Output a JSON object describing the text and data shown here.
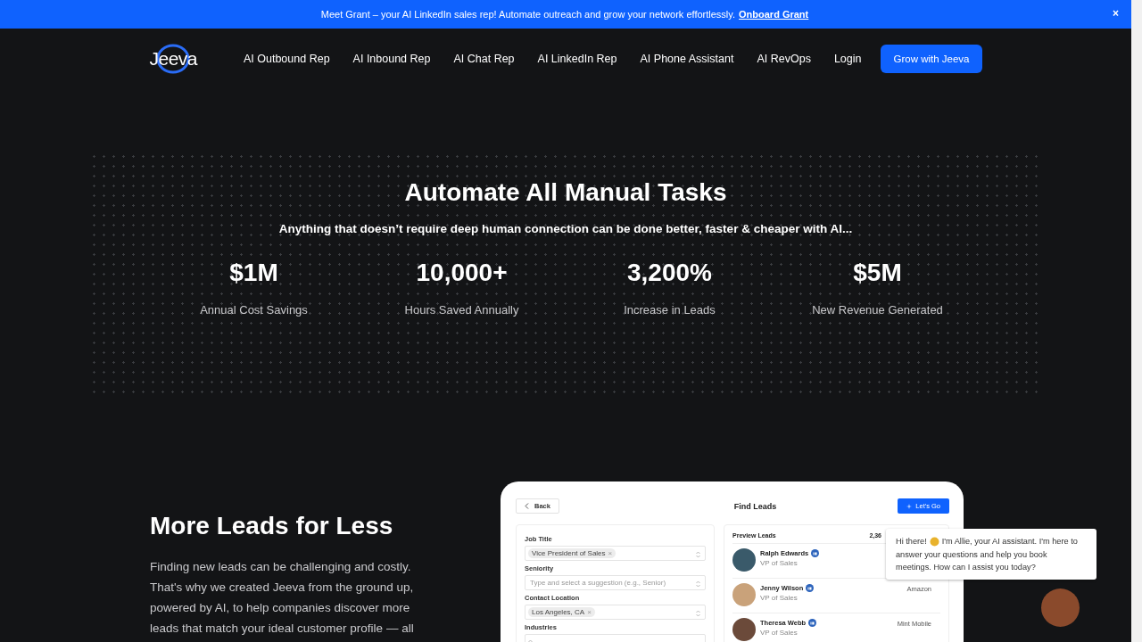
{
  "banner": {
    "text": "Meet Grant – your AI LinkedIn sales rep! Automate outreach and grow your network effortlessly.",
    "link": "Onboard Grant",
    "close": "×"
  },
  "nav": {
    "logo": "Jeeva",
    "links": [
      "AI Outbound Rep",
      "AI Inbound Rep",
      "AI Chat Rep",
      "AI LinkedIn Rep",
      "AI Phone Assistant",
      "AI RevOps",
      "Login"
    ],
    "cta": "Grow with Jeeva"
  },
  "hero": {
    "title": "Automate All Manual Tasks",
    "subtitle": "Anything that doesn’t require deep human connection can be done better, faster & cheaper with AI...",
    "stats": [
      {
        "value": "$1M",
        "label": "Annual Cost Savings"
      },
      {
        "value": "10,000+",
        "label": "Hours Saved Annually"
      },
      {
        "value": "3,200%",
        "label": "Increase in Leads"
      },
      {
        "value": "$5M",
        "label": "New Revenue Generated"
      }
    ]
  },
  "leads_section": {
    "title": "More Leads for Less",
    "body": "Finding new leads can be challenging and costly. That's why we created Jeeva from the ground up, powered by AI, to help companies discover more leads that match your ideal customer profile — all"
  },
  "find_leads": {
    "back": "Back",
    "title": "Find Leads",
    "go": "Let's Go",
    "filters": [
      {
        "label": "Job Title",
        "chip": "Vice President of Sales",
        "remove": "×"
      },
      {
        "label": "Seniority",
        "placeholder": "Type and select a suggestion (e.g., Senior)"
      },
      {
        "label": "Contact Location",
        "chip": "Los Angeles, CA",
        "remove": "×"
      },
      {
        "label": "Industries"
      }
    ],
    "preview": {
      "title": "Preview Leads",
      "count": "2,36",
      "leads": [
        {
          "name": "Ralph Edwards",
          "role": "VP of Sales"
        },
        {
          "name": "Jenny Wilson",
          "role": "VP of Sales",
          "company": "Amazon"
        },
        {
          "name": "Theresa Webb",
          "role": "VP of Sales",
          "company": "Mint Mobile"
        }
      ]
    }
  },
  "chat": {
    "greeting": "Hi there!",
    "message_start": "I'm Allie, your AI assistant. I'm here to",
    "message_rest": "answer your questions and help you book meetings. How can I assist you today?"
  }
}
